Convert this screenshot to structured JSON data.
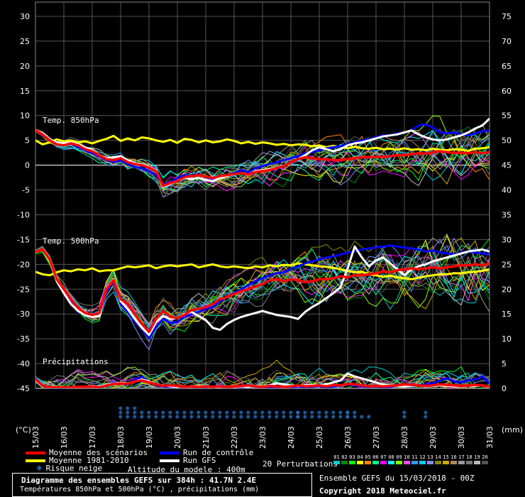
{
  "chart_data": {
    "type": "line",
    "title": "Diagramme des ensembles GEFS sur 384h : 41.7N 2.4E",
    "subtitle": "Températures 850hPa et 500hPa (°C) , précipitations (mm)",
    "left_axis": {
      "label": "(°C)",
      "ticks": [
        30,
        25,
        20,
        15,
        10,
        5,
        0,
        -5,
        -10,
        -15,
        -20,
        -25,
        -30,
        -35,
        -40,
        -45
      ],
      "range": [
        -45,
        30
      ]
    },
    "right_axis": {
      "label": "(mm)",
      "ticks": [
        75,
        70,
        65,
        60,
        55,
        50,
        45,
        40,
        35,
        30,
        25,
        20,
        15,
        10,
        5,
        0
      ],
      "range": [
        0,
        75
      ]
    },
    "x_labels": [
      "15/03",
      "16/03",
      "17/03",
      "18/03",
      "19/03",
      "20/03",
      "21/03",
      "22/03",
      "23/03",
      "24/03",
      "25/03",
      "26/03",
      "27/03",
      "28/03",
      "29/03",
      "30/03",
      "31/03"
    ],
    "panel_labels": {
      "t850": "Temp. 850hPa",
      "t500": "Temp. 500hPa",
      "precip": "Précipitations"
    },
    "series": {
      "climo_850": {
        "name": "Moyenne 1981-2010",
        "color": "#ffff00",
        "values": [
          5,
          4.2,
          4.6,
          5.2,
          4.8,
          5,
          4.6,
          4.8,
          4.4,
          4.9,
          5.3,
          5.9,
          4.9,
          5.4,
          5,
          5.6,
          5.4,
          5,
          4.7,
          5.1,
          4.5,
          5.3,
          5.1,
          4.6,
          5,
          4.6,
          4.8,
          5.2,
          4.9,
          4.4,
          4.7,
          4.3,
          4.6,
          4.4,
          4.1,
          4.3,
          4,
          4.2,
          4.1,
          3.8,
          4,
          3.6,
          3.9,
          3.6,
          3.4,
          3.7,
          3.4,
          3.3,
          3.5,
          3.2,
          3.3,
          3.1,
          3.4,
          3.1,
          3.2,
          3,
          3.3,
          3.1,
          3,
          3.2,
          3.1,
          2.9,
          3.3,
          3.4,
          3.6
        ]
      },
      "mean_850": {
        "name": "Moyenne des scénarios",
        "color": "#ff0000",
        "values": [
          7,
          6.2,
          5,
          4.2,
          4,
          4.4,
          4,
          3.2,
          2.8,
          2,
          1.2,
          1,
          1.4,
          0.6,
          0.2,
          0,
          -0.5,
          -1.2,
          -4.2,
          -3.6,
          -3.2,
          -2.4,
          -2.2,
          -2,
          -2.3,
          -2.6,
          -2.2,
          -2,
          -1.8,
          -1.6,
          -1.9,
          -1.4,
          -1.2,
          -1,
          -0.6,
          -0.2,
          0.6,
          1.2,
          1.6,
          1.4,
          1.2,
          1.2,
          1,
          1,
          1.2,
          1.4,
          1.6,
          1.6,
          1.7,
          1.6,
          1.8,
          2,
          2,
          2.2,
          2.4,
          2.3,
          2.6,
          2.8,
          2.6,
          2.5,
          2.5,
          2.4,
          2.6,
          2.4,
          2.6
        ]
      },
      "control_850": {
        "name": "Run de contrôle",
        "color": "#0000ff",
        "values": [
          7,
          6,
          5,
          4.5,
          4.2,
          4.4,
          3.6,
          3,
          2.4,
          1.8,
          1,
          0.6,
          1,
          0.2,
          -0.4,
          -0.6,
          -1.2,
          -2,
          -4,
          -3.4,
          -2.6,
          -2,
          -2.2,
          -1.8,
          -2.4,
          -2.8,
          -2.4,
          -2,
          -1.6,
          -1,
          -1.4,
          -0.6,
          -0.2,
          0.2,
          0.6,
          1,
          1.4,
          1.8,
          2.4,
          2.6,
          3,
          3.4,
          3.6,
          3.8,
          4.2,
          4.6,
          5,
          5.2,
          5.6,
          6,
          6,
          6.4,
          6.6,
          7,
          8,
          8.2,
          7.6,
          6.6,
          6.4,
          6.6,
          6.2,
          6,
          6.4,
          6.8,
          7
        ]
      },
      "gfs_850": {
        "name": "Run GFS",
        "color": "#ffffff",
        "values": [
          7,
          6.4,
          5.2,
          4.6,
          4.4,
          4.6,
          4.2,
          3.6,
          3,
          2,
          1.4,
          1.6,
          1.8,
          1,
          0.4,
          0.2,
          -0.4,
          -1,
          -4.4,
          -3.8,
          -3.2,
          -2.6,
          -2.8,
          -2.6,
          -3,
          -3.2,
          -2.6,
          -2.2,
          -1.8,
          -1.6,
          -2,
          -1.2,
          -1,
          -0.8,
          -0.6,
          -0.2,
          0.6,
          1.2,
          2,
          3,
          3.6,
          3.2,
          2.8,
          3.2,
          4,
          4.4,
          4.6,
          5,
          5.4,
          5.8,
          6,
          6.2,
          6.6,
          7,
          6.2,
          5.6,
          5.2,
          5,
          5.2,
          5.6,
          6,
          6.6,
          7.4,
          8,
          9.4
        ]
      },
      "climo_500": {
        "name": "Moyenne 1981-2010",
        "color": "#ffff00",
        "values": [
          -21.5,
          -22,
          -22.2,
          -21.6,
          -21.2,
          -21.4,
          -21,
          -21.2,
          -20.8,
          -21.4,
          -21.2,
          -21.2,
          -20.8,
          -20.4,
          -20.6,
          -20.4,
          -20.2,
          -20.8,
          -20.4,
          -20.2,
          -20.4,
          -20.2,
          -20,
          -20.6,
          -20.3,
          -20,
          -20.4,
          -20.6,
          -20.4,
          -20.6,
          -20.8,
          -20.4,
          -20.6,
          -20.2,
          -20.4,
          -20.1,
          -20.2,
          -19.8,
          -20,
          -20.2,
          -20.4,
          -20.5,
          -20.7,
          -21,
          -21.3,
          -21.6,
          -21.5,
          -22,
          -22.2,
          -22.5,
          -22.3,
          -22.6,
          -22.8,
          -23,
          -22.7,
          -22.4,
          -22.2,
          -22,
          -22,
          -21.8,
          -21.8,
          -21.6,
          -21.5,
          -21.3,
          -21
        ]
      },
      "mean_500": {
        "name": "Moyenne des scénarios",
        "color": "#ff0000",
        "values": [
          -17.5,
          -17,
          -19,
          -23,
          -25,
          -27,
          -28.8,
          -29.8,
          -30.2,
          -29.8,
          -25,
          -23.2,
          -27,
          -28,
          -30,
          -32,
          -33.6,
          -31,
          -29.4,
          -30.6,
          -30.8,
          -30.2,
          -29.2,
          -29,
          -28.6,
          -28,
          -27,
          -26.6,
          -26,
          -25.4,
          -25,
          -24.4,
          -24,
          -23.2,
          -23,
          -23.4,
          -23,
          -23.2,
          -23.6,
          -23.4,
          -23,
          -23,
          -22.8,
          -22.4,
          -22.6,
          -22.2,
          -22.2,
          -22,
          -21.8,
          -21.4,
          -21.6,
          -21.2,
          -21,
          -20.8,
          -21,
          -20.8,
          -20.6,
          -20.8,
          -20.6,
          -20.4,
          -20.2,
          -20.2,
          -20,
          -20.2,
          -19.8
        ]
      },
      "control_500": {
        "name": "Run de contrôle",
        "color": "#0000ff",
        "values": [
          -17.5,
          -17,
          -19,
          -23,
          -25.4,
          -27.8,
          -29.6,
          -30,
          -30.6,
          -30.2,
          -25.8,
          -23.6,
          -28,
          -29.6,
          -31.6,
          -33,
          -35,
          -32.6,
          -31,
          -31.8,
          -31.6,
          -30.6,
          -30,
          -29.6,
          -29,
          -28.6,
          -27.4,
          -26.6,
          -25.8,
          -25,
          -24.2,
          -23.4,
          -22.8,
          -22.2,
          -21.8,
          -21.6,
          -21,
          -20.4,
          -19.8,
          -19.4,
          -19,
          -18.6,
          -18.4,
          -18,
          -17.6,
          -17.4,
          -17,
          -16.8,
          -16.6,
          -16.4,
          -16.2,
          -16.4,
          -16.6,
          -16.8,
          -17,
          -17.4,
          -17.2,
          -17.6,
          -17.8,
          -18,
          -17.6,
          -17.4,
          -17.6,
          -17.8,
          -18
        ]
      },
      "gfs_500": {
        "name": "Run GFS",
        "color": "#ffffff",
        "values": [
          -17.5,
          -17,
          -19.2,
          -23.4,
          -25.8,
          -28,
          -29.4,
          -30.2,
          -30.6,
          -30.4,
          -25,
          -23,
          -27.4,
          -29,
          -31,
          -32.8,
          -34.2,
          -31.6,
          -30.4,
          -31,
          -30.8,
          -30,
          -29.6,
          -30.4,
          -31.2,
          -32.8,
          -33.2,
          -32,
          -31.2,
          -30.6,
          -30.2,
          -29.8,
          -29.4,
          -29.8,
          -30.2,
          -30.4,
          -30.6,
          -31,
          -29.6,
          -28.6,
          -27.8,
          -26.8,
          -25.8,
          -24.6,
          -20.8,
          -16.4,
          -18.6,
          -20.4,
          -19.2,
          -18.6,
          -19.8,
          -21,
          -22.2,
          -21,
          -20.4,
          -20,
          -19.4,
          -19,
          -18.6,
          -18.2,
          -17.8,
          -17.4,
          -17.2,
          -17,
          -17.4
        ]
      },
      "mean_precip": {
        "name": "Moyenne des scénarios",
        "color": "#ff0000",
        "values": [
          1.8,
          0.6,
          0.2,
          0.2,
          0.2,
          0.2,
          0.3,
          0.3,
          0.4,
          0.2,
          0.6,
          0.9,
          1,
          0.9,
          1.4,
          1.6,
          1.2,
          0.8,
          0.5,
          0.6,
          0.5,
          0.3,
          0.4,
          0.3,
          0.4,
          0.3,
          0.4,
          0.3,
          0.4,
          0.5,
          0.6,
          0.4,
          0.3,
          0.5,
          0.4,
          0.3,
          0.4,
          0.6,
          0.4,
          0.5,
          0.6,
          0.4,
          0.7,
          0.6,
          0.9,
          0.8,
          0.6,
          0.4,
          0.5,
          0.4,
          0.5,
          0.6,
          0.8,
          0.7,
          0.6,
          0.5,
          0.6,
          0.8,
          0.7,
          0.6,
          0.5,
          0.6,
          0.7,
          0.6,
          0.4
        ]
      },
      "control_precip": {
        "name": "Run de contrôle",
        "color": "#0000ff",
        "values": [
          2,
          0.6,
          0.1,
          0.1,
          0.1,
          0.2,
          0.3,
          0.2,
          0.4,
          0.2,
          0.8,
          1.2,
          1,
          0.8,
          1.8,
          2.4,
          1.2,
          0.6,
          0.4,
          0.3,
          0.2,
          0.3,
          0.2,
          0.1,
          0.2,
          0.1,
          0.2,
          0.3,
          0.2,
          0.3,
          0.2,
          0.5,
          0.2,
          0.3,
          0.2,
          0.3,
          0.2,
          0.4,
          0.2,
          0.3,
          0.5,
          0.2,
          0.4,
          0.6,
          0.8,
          0.6,
          0.4,
          0.3,
          0.4,
          0.2,
          0.3,
          0.5,
          0.6,
          0.4,
          0.6,
          0.8,
          1,
          1.6,
          2,
          1.4,
          1.2,
          1.6,
          1.8,
          2.4,
          1
        ]
      },
      "gfs_precip": {
        "name": "Run GFS",
        "color": "#ffffff",
        "values": [
          1.6,
          0.6,
          0.2,
          0.2,
          0.2,
          0.2,
          0.3,
          0.3,
          0.5,
          0.3,
          0.8,
          1,
          1.1,
          1,
          1.4,
          1.8,
          1.4,
          0.8,
          0.6,
          0.4,
          0.3,
          0.4,
          0.3,
          0.5,
          0.4,
          0.2,
          0.3,
          0.4,
          0.3,
          0.4,
          0.3,
          0.5,
          0.4,
          0.6,
          1,
          0.8,
          0.6,
          0.5,
          0.6,
          0.7,
          0.6,
          0.8,
          1.2,
          1.6,
          3,
          2.4,
          2,
          1.6,
          1.2,
          0.8,
          0.6,
          0.5,
          0.4,
          0.5,
          0.6,
          0.4,
          0.5,
          0.6,
          0.5,
          0.4,
          0.5,
          0.6,
          0.5,
          0.6,
          0.4
        ]
      }
    },
    "snow_columns": [
      {
        "i": 12,
        "n": 3
      },
      {
        "i": 13,
        "n": 3
      },
      {
        "i": 14,
        "n": 3
      },
      {
        "i": 15,
        "n": 2
      },
      {
        "i": 16,
        "n": 2
      },
      {
        "i": 17,
        "n": 2
      },
      {
        "i": 18,
        "n": 2
      },
      {
        "i": 19,
        "n": 2
      },
      {
        "i": 20,
        "n": 2
      },
      {
        "i": 21,
        "n": 2
      },
      {
        "i": 22,
        "n": 2
      },
      {
        "i": 23,
        "n": 2
      },
      {
        "i": 24,
        "n": 2
      },
      {
        "i": 25,
        "n": 2
      },
      {
        "i": 26,
        "n": 2
      },
      {
        "i": 27,
        "n": 2
      },
      {
        "i": 28,
        "n": 2
      },
      {
        "i": 29,
        "n": 2
      },
      {
        "i": 30,
        "n": 2
      },
      {
        "i": 31,
        "n": 2
      },
      {
        "i": 32,
        "n": 2
      },
      {
        "i": 33,
        "n": 2
      },
      {
        "i": 34,
        "n": 2
      },
      {
        "i": 35,
        "n": 2
      },
      {
        "i": 36,
        "n": 2
      },
      {
        "i": 37,
        "n": 2
      },
      {
        "i": 38,
        "n": 2
      },
      {
        "i": 39,
        "n": 2
      },
      {
        "i": 40,
        "n": 2
      },
      {
        "i": 41,
        "n": 2
      },
      {
        "i": 42,
        "n": 2
      },
      {
        "i": 43,
        "n": 2
      },
      {
        "i": 44,
        "n": 2
      },
      {
        "i": 45,
        "n": 2
      },
      {
        "i": 46,
        "n": 1
      },
      {
        "i": 47,
        "n": 1
      }
    ]
  },
  "legend": {
    "mean": "Moyenne des scénarios",
    "climo": "Moyenne 1981-2010",
    "snow": "Risque neige",
    "control": "Run de contrôle",
    "gfs": "Run GFS",
    "altitude": "Altitude du modele : 400m",
    "perturbations_label": "20 Perturbations",
    "perturbations": [
      "01",
      "02",
      "03",
      "04",
      "05",
      "06",
      "07",
      "08",
      "09",
      "10",
      "11",
      "12",
      "13",
      "14",
      "15",
      "16",
      "17",
      "18",
      "19",
      "20"
    ],
    "perturbation_colors": [
      "#00cccc",
      "#008800",
      "#00ff00",
      "#ffff00",
      "#ff8800",
      "#00ff88",
      "#ff00ff",
      "#00ffff",
      "#88ff00",
      "#ff44ff",
      "#3399ff",
      "#00ccff",
      "#8888ff",
      "#888800",
      "#ccaa00",
      "#aa8866",
      "#999999",
      "#777777",
      "#bbbbbb",
      "#555555"
    ]
  },
  "footer": {
    "title": "Diagramme des ensembles GEFS sur 384h : 41.7N 2.4E",
    "subtitle": "Températures 850hPa et 500hPa (°C) , précipitations (mm)",
    "run": "Ensemble GEFS du 15/03/2018 - 00Z",
    "copyright": "Copyright 2018 Meteociel.fr"
  }
}
